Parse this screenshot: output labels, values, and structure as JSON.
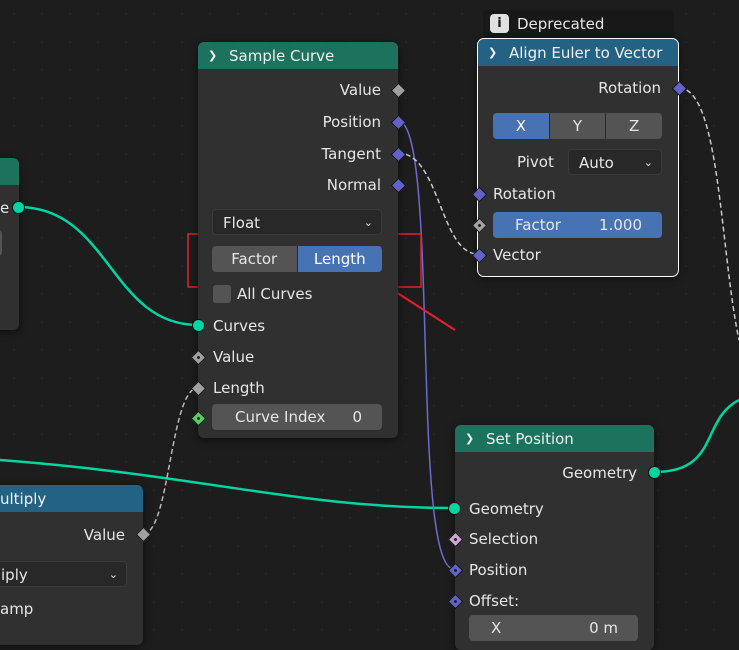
{
  "sample_curve": {
    "title": "Sample Curve",
    "outputs": [
      "Value",
      "Position",
      "Tangent",
      "Normal"
    ],
    "data_type": "Float",
    "mode": {
      "options": [
        "Factor",
        "Length"
      ],
      "selected": "Length"
    },
    "all_curves_label": "All Curves",
    "inputs": {
      "curves": "Curves",
      "value": "Value",
      "length": "Length"
    },
    "curve_index": {
      "label": "Curve Index",
      "value": "0"
    }
  },
  "align_euler": {
    "tooltip": "Deprecated",
    "title": "Align Euler to Vector",
    "output_rotation": "Rotation",
    "axis": {
      "options": [
        "X",
        "Y",
        "Z"
      ],
      "selected": "X"
    },
    "pivot_label": "Pivot",
    "pivot_value": "Auto",
    "input_rotation": "Rotation",
    "factor": {
      "label": "Factor",
      "value": "1.000"
    },
    "vector": "Vector"
  },
  "set_position": {
    "title": "Set Position",
    "output_geometry": "Geometry",
    "inputs": [
      "Geometry",
      "Selection",
      "Position",
      "Offset:"
    ],
    "offset_x": {
      "label": "X",
      "value": "0 m"
    }
  },
  "multiply_node": {
    "title_partial": "ultiply",
    "output": "Value",
    "op_partial": "iply",
    "clamp_partial": "amp"
  },
  "left_node": {
    "socket_label_partial": "e"
  },
  "colors": {
    "geometry": "#00d6a3",
    "vector": "#6363c7",
    "float": "#a1a1a1",
    "integer": "#63c763",
    "highlight": "#e8202a",
    "selected": "#4772b3"
  }
}
